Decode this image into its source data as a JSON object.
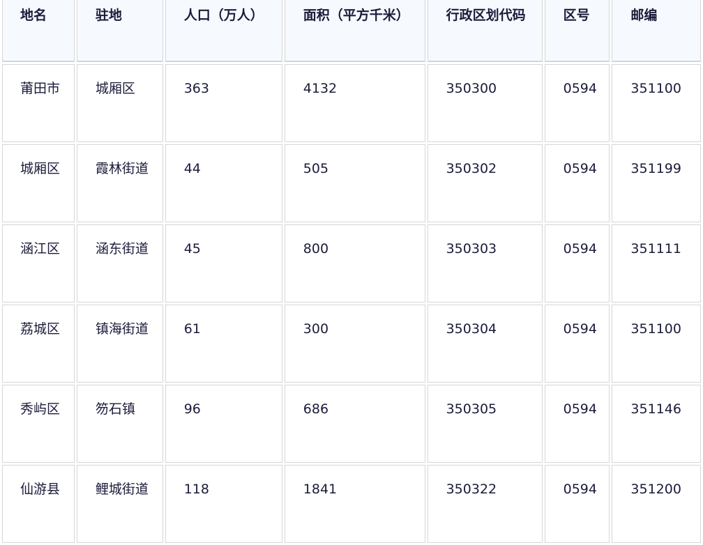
{
  "table": {
    "headers": [
      "地名",
      "驻地",
      "人口（万人）",
      "面积（平方千米）",
      "行政区划代码",
      "区号",
      "邮编"
    ],
    "rows": [
      [
        "莆田市",
        "城厢区",
        "363",
        "4132",
        "350300",
        "0594",
        "351100"
      ],
      [
        "城厢区",
        "霞林街道",
        "44",
        "505",
        "350302",
        "0594",
        "351199"
      ],
      [
        "涵江区",
        "涵东街道",
        "45",
        "800",
        "350303",
        "0594",
        "351111"
      ],
      [
        "荔城区",
        "镇海街道",
        "61",
        "300",
        "350304",
        "0594",
        "351100"
      ],
      [
        "秀屿区",
        "笏石镇",
        "96",
        "686",
        "350305",
        "0594",
        "351146"
      ],
      [
        "仙游县",
        "鲤城街道",
        "118",
        "1841",
        "350322",
        "0594",
        "351200"
      ]
    ]
  }
}
